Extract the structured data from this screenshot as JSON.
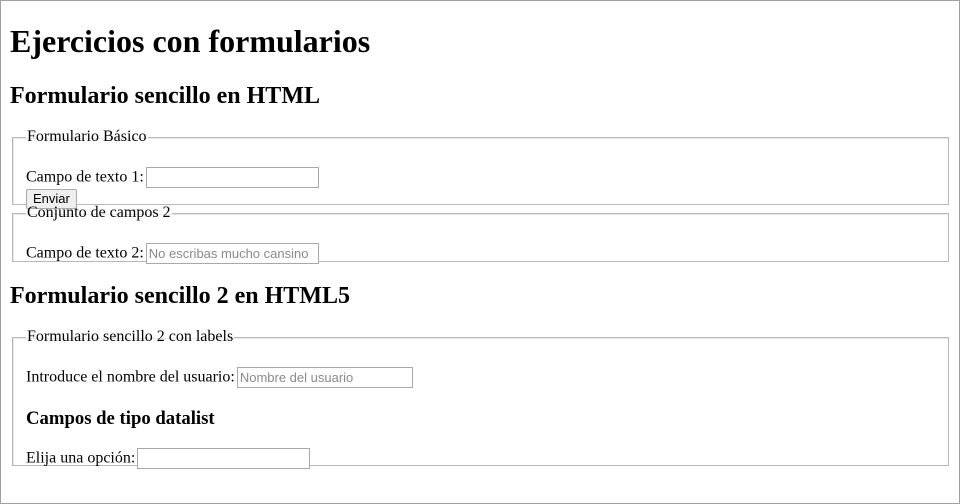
{
  "title": "Ejercicios con formularios",
  "section1": {
    "heading": "Formulario sencillo en HTML",
    "fieldset1": {
      "legend": "Formulario Básico",
      "field_label": "Campo de texto 1:",
      "field_value": "",
      "submit_label": "Enviar"
    },
    "fieldset2": {
      "legend": "Conjunto de campos 2",
      "field_label": "Campo de texto 2:",
      "field_placeholder": "No escribas mucho cansino"
    }
  },
  "section2": {
    "heading": "Formulario sencillo 2 en HTML5",
    "fieldset": {
      "legend": "Formulario sencillo 2 con labels",
      "user_label": "Introduce el nombre del usuario:",
      "user_placeholder": "Nombre del usuario",
      "datalist_heading": "Campos de tipo datalist",
      "option_label": "Elija una opción:",
      "option_value": ""
    }
  }
}
